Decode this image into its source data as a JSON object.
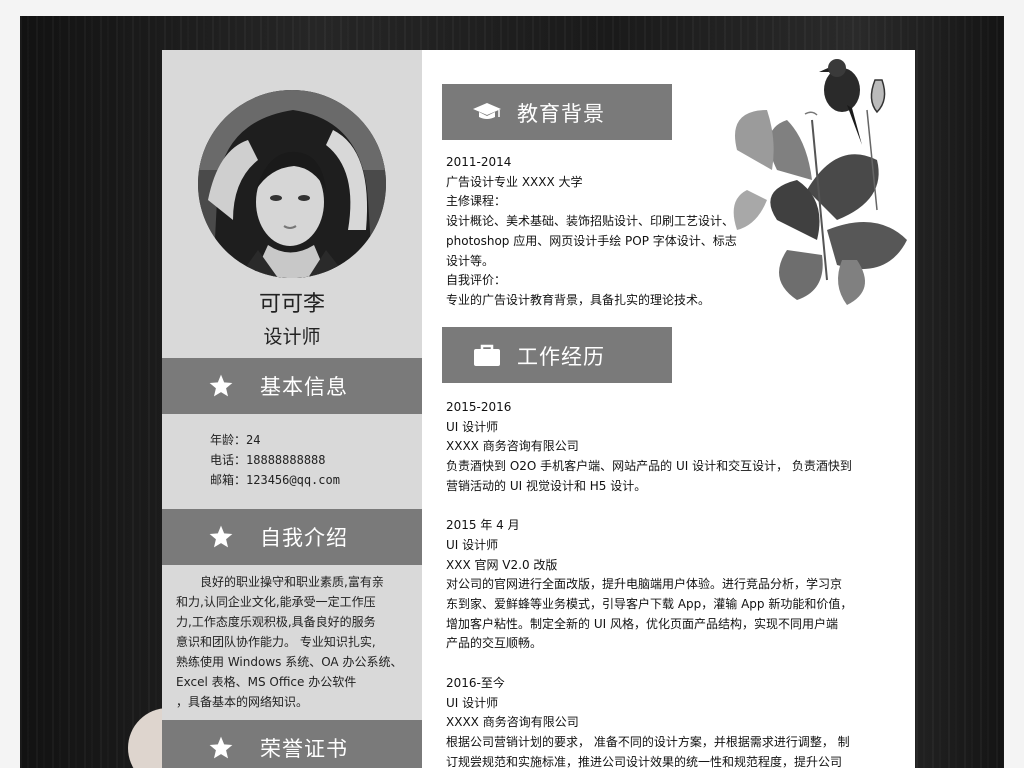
{
  "profile": {
    "name": "可可李",
    "title": "设计师"
  },
  "sections": {
    "basic_info": "基本信息",
    "self_intro": "自我介绍",
    "honors": "荣誉证书",
    "education": "教育背景",
    "work": "工作经历"
  },
  "basic_info": {
    "age_label": "年龄：",
    "age": "24",
    "phone_label": "电话：",
    "phone": "18888888888",
    "email_label": "邮箱：",
    "email": "123456@qq.com"
  },
  "self_intro_lines": [
    "　　良好的职业操守和职业素质,富有亲",
    "和力,认同企业文化,能承受一定工作压",
    "力,工作态度乐观积极,具备良好的服务",
    "意识和团队协作能力。 专业知识扎实,",
    "熟练使用 Windows 系统、OA 办公系统、",
    "Excel 表格、MS Office 办公软件",
    "，具备基本的网络知识。"
  ],
  "education_lines": [
    "2011-2014",
    "广告设计专业 XXXX 大学",
    "主修课程：",
    "设计概论、美术基础、装饰招贴设计、印刷工艺设计、",
    "photoshop 应用、网页设计手绘 POP 字体设计、标志",
    "设计等。",
    "自我评价：",
    "专业的广告设计教育背景，具备扎实的理论技术。"
  ],
  "work_lines": [
    "2015-2016",
    "UI 设计师",
    "XXXX 商务咨询有限公司",
    "负责酒快到 O2O 手机客户端、网站产品的 UI 设计和交互设计， 负责酒快到",
    "营销活动的 UI 视觉设计和 H5 设计。",
    "",
    "2015 年 4 月",
    "UI 设计师",
    "XXX 官网 V2.0 改版",
    "对公司的官网进行全面改版，提升电脑端用户体验。进行竞品分析，学习京",
    "东到家、爱鲜蜂等业务模式，引导客户下载 App，灌输 App 新功能和价值，",
    "增加客户粘性。制定全新的 UI 风格，优化页面产品结构，实现不同用户端",
    "产品的交互顺畅。",
    "",
    "2016-至今",
    "UI 设计师",
    "XXXX 商务咨询有限公司",
    "根据公司营销计划的要求， 准备不同的设计方案，并根据需求进行调整， 制",
    "订规尝规范和实施标准，推进公司设计效果的统一性和规范程度，提升公司"
  ],
  "icons": {
    "basic_info": "star-icon",
    "self_intro": "star-icon",
    "honors": "star-icon",
    "education": "graduation-cap-icon",
    "work": "briefcase-icon"
  },
  "colors": {
    "sidebar": "#d9d9d9",
    "header_bar": "#7a7a7a",
    "paper": "#ffffff",
    "background": "#1c1c1c"
  }
}
